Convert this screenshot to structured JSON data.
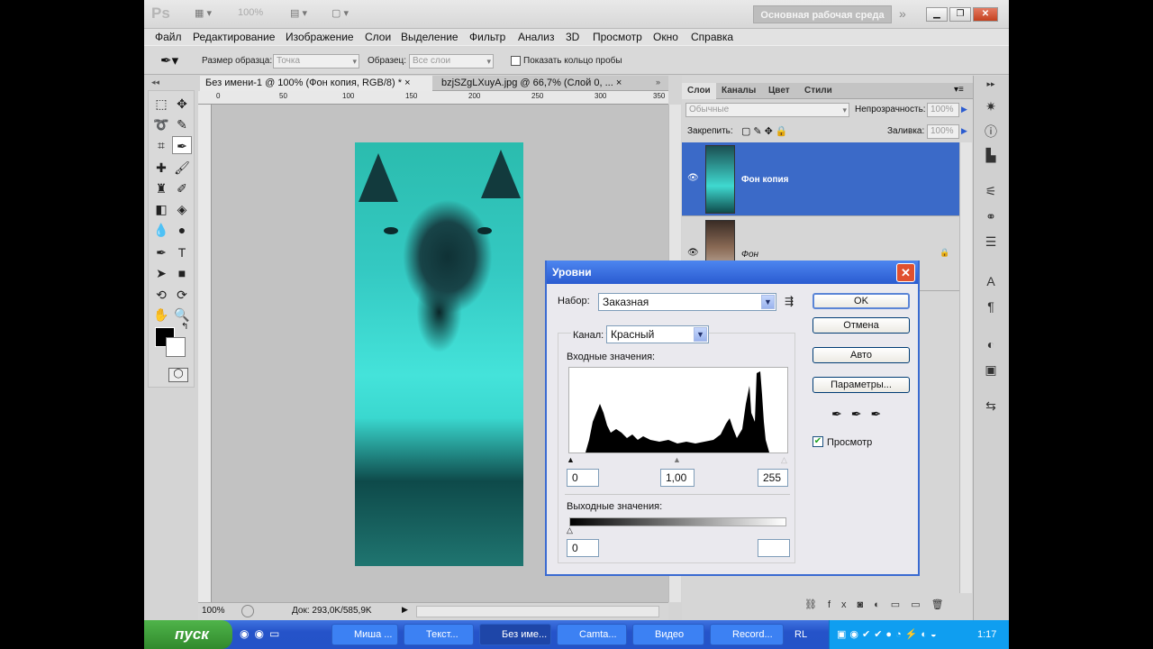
{
  "appbar": {
    "logo": "Ps",
    "zoom": "100%",
    "workspace_label": "Основная рабочая среда",
    "more": "»"
  },
  "menu": [
    "Файл",
    "Редактирование",
    "Изображение",
    "Слои",
    "Выделение",
    "Фильтр",
    "Анализ",
    "3D",
    "Просмотр",
    "Окно",
    "Справка"
  ],
  "options": {
    "sample_size_label": "Размер образца:",
    "sample_size_value": "Точка",
    "sample_label": "Образец:",
    "sample_value": "Все слои",
    "show_ring_label": "Показать кольцо пробы"
  },
  "tabs": [
    {
      "label": "Без имени-1 @ 100% (Фон копия, RGB/8) *",
      "close": "×"
    },
    {
      "label": "bzjSZgLXuyA.jpg @ 66,7% (Слой 0, ...",
      "close": "×"
    }
  ],
  "ruler_marks": [
    "0",
    "50",
    "100",
    "150",
    "200",
    "250",
    "300",
    "350"
  ],
  "status": {
    "zoom": "100%",
    "doc": "Док: 293,0K/585,9K"
  },
  "layers_panel": {
    "tabs": [
      "Слои",
      "Каналы",
      "Цвет",
      "Стили"
    ],
    "blend_mode": "Обычные",
    "opacity_label": "Непрозрачность:",
    "opacity_value": "100%",
    "lock_label": "Закрепить:",
    "fill_label": "Заливка:",
    "fill_value": "100%",
    "layers": [
      {
        "name": "Фон копия",
        "selected": true
      },
      {
        "name": "Фон",
        "selected": false
      }
    ]
  },
  "levels_dialog": {
    "title": "Уровни",
    "preset_label": "Набор:",
    "preset_value": "Заказная",
    "channel_label": "Канал:",
    "channel_value": "Красный",
    "input_label": "Входные значения:",
    "input_black": "0",
    "input_gamma": "1,00",
    "input_white": "255",
    "output_label": "Выходные значения:",
    "output_black": "0",
    "output_white": "",
    "buttons": {
      "ok": "OK",
      "cancel": "Отмена",
      "auto": "Авто",
      "options": "Параметры..."
    },
    "preview_label": "Просмотр",
    "preview_checked": true
  },
  "taskbar": {
    "start": "пуск",
    "tasks": [
      "Миша ...",
      "Текст...",
      "Без име...",
      "Camta...",
      "Видео",
      "Record..."
    ],
    "lang": "RL",
    "clock": "1:17"
  },
  "colors": {
    "selection_blue": "#3b6ac8",
    "dialog_title": "#2a5bd0",
    "photo_cyan": "#3fd9d0"
  }
}
